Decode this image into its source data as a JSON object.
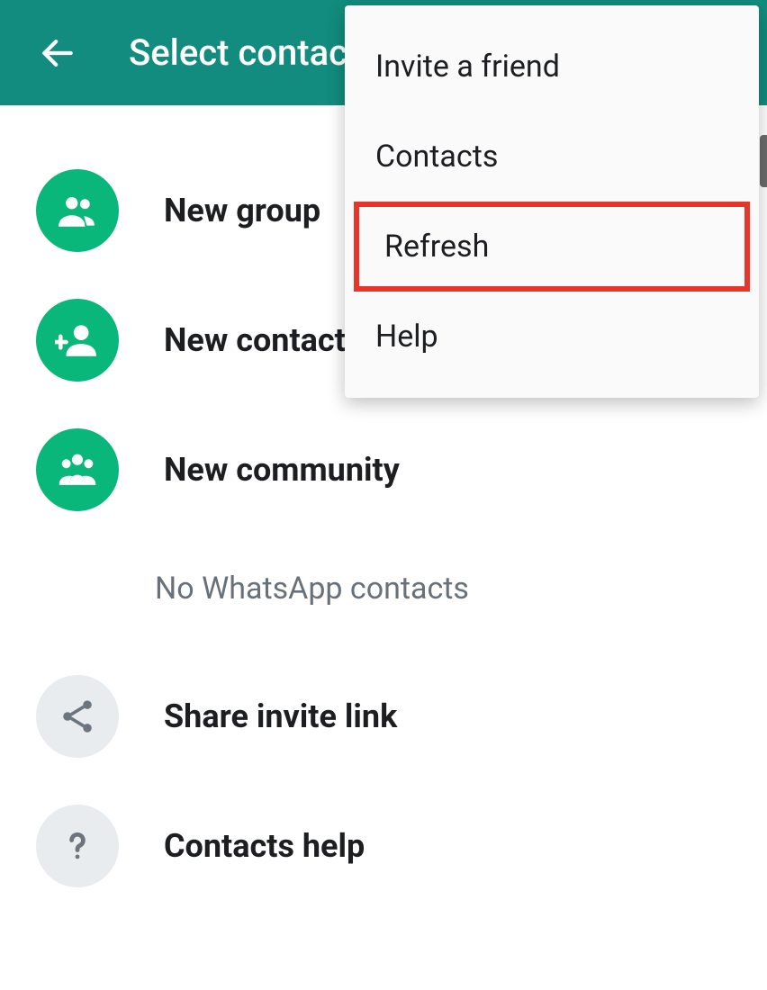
{
  "header": {
    "title": "Select contact"
  },
  "actions": {
    "new_group": "New group",
    "new_contact": "New contact",
    "new_community": "New community"
  },
  "empty_state": "No WhatsApp contacts",
  "secondary": {
    "share_link": "Share invite link",
    "contacts_help": "Contacts help"
  },
  "menu": {
    "invite": "Invite a friend",
    "contacts": "Contacts",
    "refresh": "Refresh",
    "help": "Help"
  }
}
